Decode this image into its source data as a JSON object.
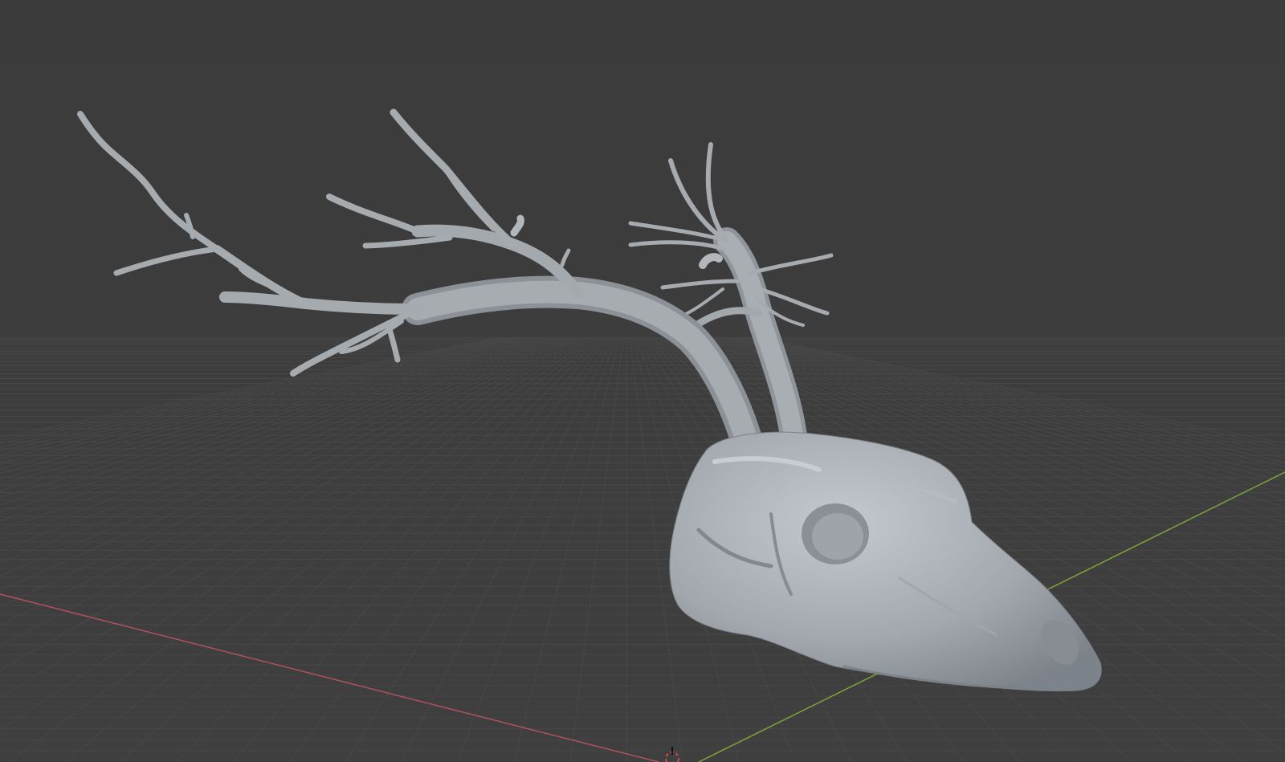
{
  "viewport": {
    "background": "#3d3d3d",
    "grid_color": "#4a4a4a",
    "x_axis_color": "#b0535c",
    "y_axis_color": "#7fa33a",
    "model_color": "#9aa0a6",
    "model_highlight": "#b8bdc2",
    "model_shadow": "#6f757b",
    "object": {
      "name": "deer-skull-with-antlers"
    },
    "cursor_icon": "3d-cursor-icon"
  }
}
